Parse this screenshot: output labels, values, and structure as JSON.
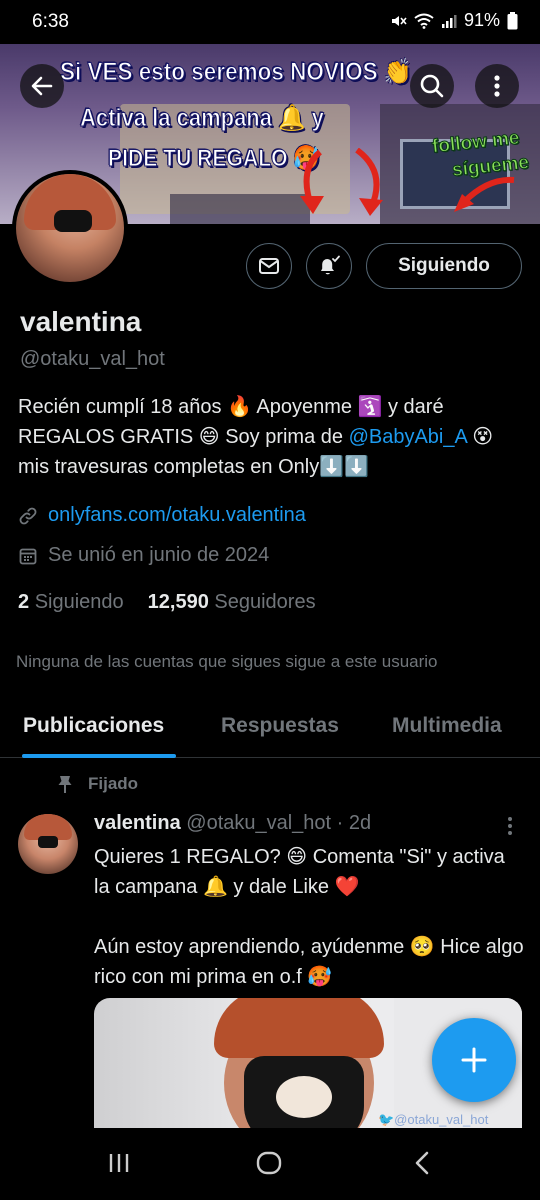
{
  "status_bar": {
    "time": "6:38",
    "battery": "91%"
  },
  "banner": {
    "line1": "Si VES esto seremos NOVIOS 👏",
    "line2": "Activa la campana 🔔 y",
    "line3": "PIDE TU REGALO 🥵",
    "sticker1": "follow me",
    "sticker2": "sígueme"
  },
  "profile": {
    "name": "valentina",
    "handle": "@otaku_val_hot",
    "bio_part1": "Recién cumplí 18 años 🔥 Apoyenme 🛐 y daré REGALOS GRATIS 😄 Soy prima de ",
    "bio_mention": "@BabyAbi_A",
    "bio_part2": " 😵 mis travesuras completas en Only⬇️⬇️",
    "link": "onlyfans.com/otaku.valentina",
    "joined": "Se unió en junio de 2024",
    "following_count": "2",
    "following_label": "Siguiendo",
    "followers_count": "12,590",
    "followers_label": "Seguidores",
    "notice": "Ninguna de las cuentas que sigues sigue a este usuario"
  },
  "actions": {
    "following_button": "Siguiendo"
  },
  "tabs": [
    {
      "label": "Publicaciones",
      "active": true
    },
    {
      "label": "Respuestas",
      "active": false
    },
    {
      "label": "Multimedia",
      "active": false
    }
  ],
  "post": {
    "pinned_label": "Fijado",
    "author": "valentina",
    "handle": "@otaku_val_hot",
    "separator": "·",
    "time": "2d",
    "text": "Quieres 1 REGALO? 😄 Comenta \"Si\" y activa la campana 🔔 y dale Like ❤️\n\nAún estoy aprendiendo, ayúdenme 🥺 Hice algo rico con mi prima en o.f 🥵",
    "media_watermark": "🐦@otaku_val_hot"
  },
  "colors": {
    "background": "#000000",
    "accent": "#1d9bf0",
    "text_primary": "#e7e9ea",
    "text_secondary": "#71767b",
    "border": "#536471"
  },
  "icons": {
    "back": "arrow-left-icon",
    "search": "search-icon",
    "more": "more-vertical-icon",
    "dm": "envelope-icon",
    "bell": "bell-check-icon",
    "link": "link-icon",
    "calendar": "calendar-icon",
    "pin": "pin-icon",
    "compose": "plus-icon"
  }
}
